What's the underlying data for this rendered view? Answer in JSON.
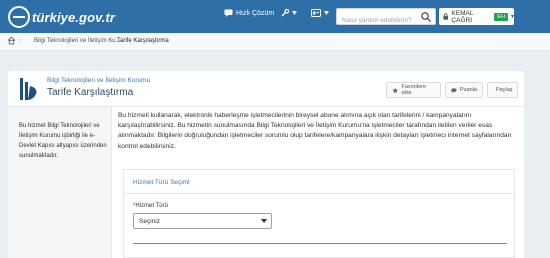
{
  "header": {
    "logo_text": "türkiye.gov.tr",
    "quick_solution_label": "Hızlı Çözüm",
    "search_placeholder": "Nasıl yardım edebilirim?",
    "user_name": "KEMAL ÇAĞRI",
    "user_badge": "EH",
    "colors": {
      "bar": "#2f6fa7",
      "badge": "#25a148"
    }
  },
  "breadcrumb": {
    "items": [
      "Bilgi Teknolojileri ve İletişim Ku...",
      "Tarife Karşılaştırma"
    ]
  },
  "page": {
    "institution_name": "Bilgi Teknolojileri ve İletişim Kurumu",
    "title": "Tarife Karşılaştırma",
    "actions": {
      "favorite_label": "Favorilere ekle",
      "rate_label": "Puanla",
      "share_label": "Paylaş"
    }
  },
  "sidebar": {
    "text": "Bu hizmet Bilgi Teknolojileri ve İletişim Kurumu işbirliği ile e-Devlet Kapısı altyapısı üzerinden sunulmaktadır."
  },
  "main": {
    "description": "Bu hizmeti kullanarak, elektronik haberleşme işletmecilerinin bireysel abone alımına açık olan tarifelerini / kampanyalarını karşılaştırabilirsiniz. Bu hizmetin sunulmasında Bilgi Teknolojileri ve İletişim Kurumu'na işletmeciler tarafından iletilen veriler esas alınmaktadır. Bilgilerin doğruluğundan işletmeciler sorumlu olup tarifelere/kampanyalara ilişkin detayları işletmeci internet sayfalarından kontrol edebilirsiniz.",
    "card_title": "Hizmet Türü Seçimi",
    "field_required_mark": "*",
    "field_label": "Hizmet Türü",
    "select_value": "Seçiniz"
  }
}
